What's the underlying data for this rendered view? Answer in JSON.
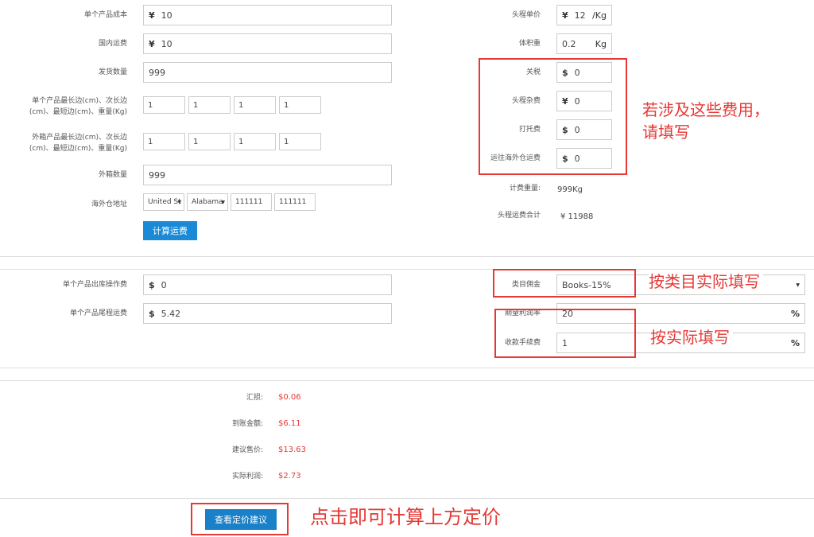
{
  "left_form": {
    "unit_cost": {
      "label": "单个产品成本",
      "prefix": "¥",
      "value": "10"
    },
    "domestic_shipping": {
      "label": "国内运费",
      "prefix": "¥",
      "value": "10"
    },
    "ship_qty": {
      "label": "发货数量",
      "value": "999"
    },
    "product_dims": {
      "label": "单个产品最长边(cm)、次长边(cm)、最短边(cm)、重量(Kg)",
      "values": [
        "1",
        "1",
        "1",
        "1"
      ]
    },
    "carton_dims": {
      "label": "外箱产品最长边(cm)、次长边(cm)、最短边(cm)、重量(Kg)",
      "values": [
        "1",
        "1",
        "1",
        "1"
      ]
    },
    "carton_qty": {
      "label": "外箱数量",
      "value": "999"
    },
    "warehouse_address": {
      "label": "海外仓地址",
      "country": "United St",
      "state": "Alabama",
      "zip1": "111111",
      "zip2": "111111"
    },
    "calc_button": "计算运费"
  },
  "right_form": {
    "first_leg_price": {
      "label": "头程单价",
      "prefix": "¥",
      "value": "12",
      "suffix": "/Kg"
    },
    "volume_weight": {
      "label": "体积重",
      "value": "0.2",
      "suffix": "Kg"
    },
    "tariff": {
      "label": "关税",
      "prefix": "$",
      "value": "0"
    },
    "first_leg_misc": {
      "label": "头程杂费",
      "prefix": "¥",
      "value": "0"
    },
    "tray_fee": {
      "label": "打托费",
      "prefix": "$",
      "value": "0"
    },
    "to_warehouse_fee": {
      "label": "运往海外仓运费",
      "prefix": "$",
      "value": "0"
    },
    "billing_weight": {
      "label": "计费重量:",
      "value": "999Kg"
    },
    "first_leg_total": {
      "label": "头程运费合计",
      "value": "¥ 11988"
    }
  },
  "section2": {
    "outbound_fee": {
      "label": "单个产品出库操作费",
      "prefix": "$",
      "value": "0"
    },
    "last_mile_fee": {
      "label": "单个产品尾程运费",
      "prefix": "$",
      "value": "5.42"
    },
    "category_commission": {
      "label": "类目佣金",
      "value": "Books-15%"
    },
    "expected_margin": {
      "label": "期望利润率",
      "value": "20",
      "suffix": "%"
    },
    "payment_fee": {
      "label": "收款手续费",
      "value": "1",
      "suffix": "%"
    }
  },
  "results": {
    "fx_loss": {
      "label": "汇损:",
      "value": "$0.06"
    },
    "received": {
      "label": "到账金额:",
      "value": "$6.11"
    },
    "suggested_price": {
      "label": "建议售价:",
      "value": "$13.63"
    },
    "actual_profit": {
      "label": "实际利润:",
      "value": "$2.73"
    }
  },
  "pricing_button": "查看定价建议",
  "annotations": {
    "fees_note": "若涉及这些费用，\n请填写",
    "category_note": "按类目实际填写",
    "actual_note": "按实际填写",
    "button_note": "点击即可计算上方定价"
  },
  "colors": {
    "accent": "#1a8ad6",
    "annotation_red": "#e53935",
    "result_red": "#e53935"
  }
}
